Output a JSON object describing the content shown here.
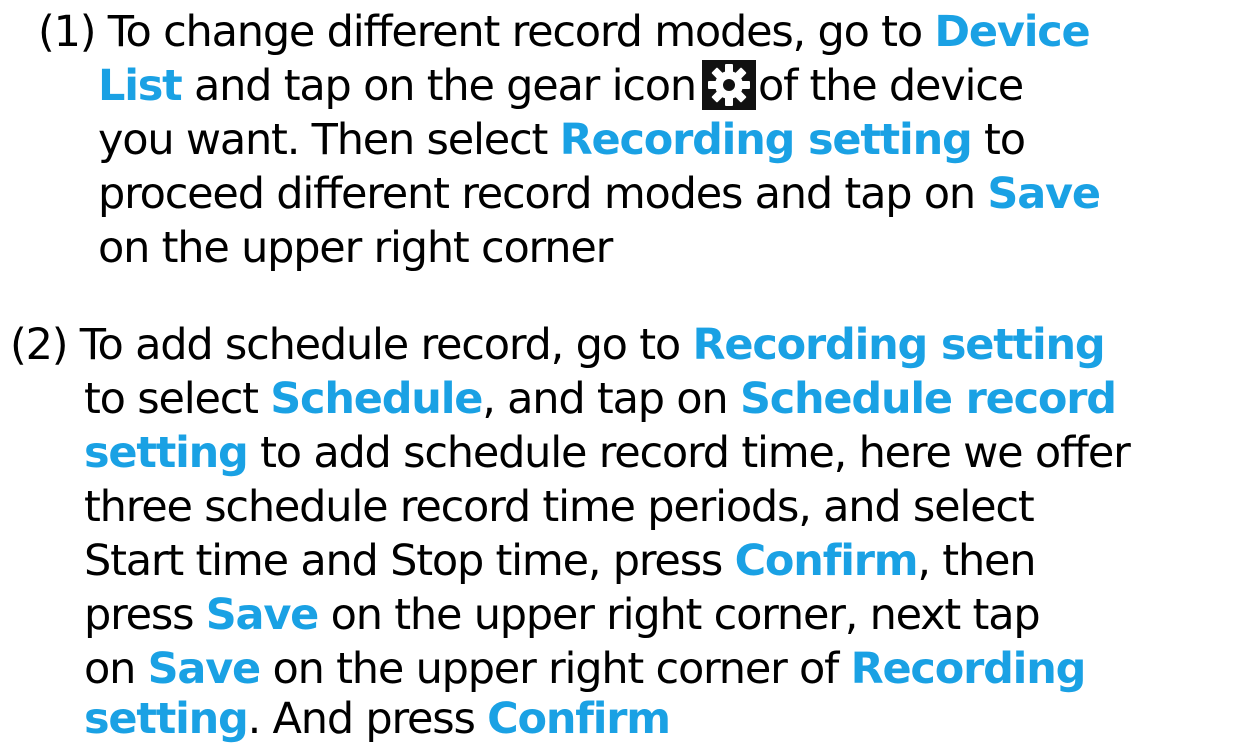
{
  "accent_color": "#1aa1e4",
  "step1": {
    "number": "(1)",
    "t1": "To change different record modes, go to",
    "k1": "Device",
    "k1b": "List",
    "t2": "and tap on the gear icon",
    "icon": "gear-icon",
    "t3": "of the device",
    "t4": "you want. Then select",
    "k2": "Recording setting",
    "t5": "to",
    "t6": "proceed different record modes and tap on",
    "k3": "Save",
    "t7": "on the upper right corner"
  },
  "step2": {
    "number": "(2)",
    "t1": "To add schedule record, go to",
    "k1": "Recording setting",
    "t2": "to select",
    "k2": "Schedule",
    "t3": ", and tap on",
    "k3": "Schedule record",
    "k3b": "setting",
    "t4": "to add schedule record time, here we offer",
    "t5": "three schedule record time periods, and select",
    "t6": "Start time and Stop time, press",
    "k4": "Confirm",
    "t7": ", then",
    "t8": "press",
    "k5": "Save",
    "t9": "on the upper right corner, next tap",
    "t10": "on",
    "k6": "Save",
    "t11": "on the upper right corner of",
    "k7": "Recording",
    "k7b": "setting",
    "t12": ". And press",
    "k8": "Confirm"
  }
}
